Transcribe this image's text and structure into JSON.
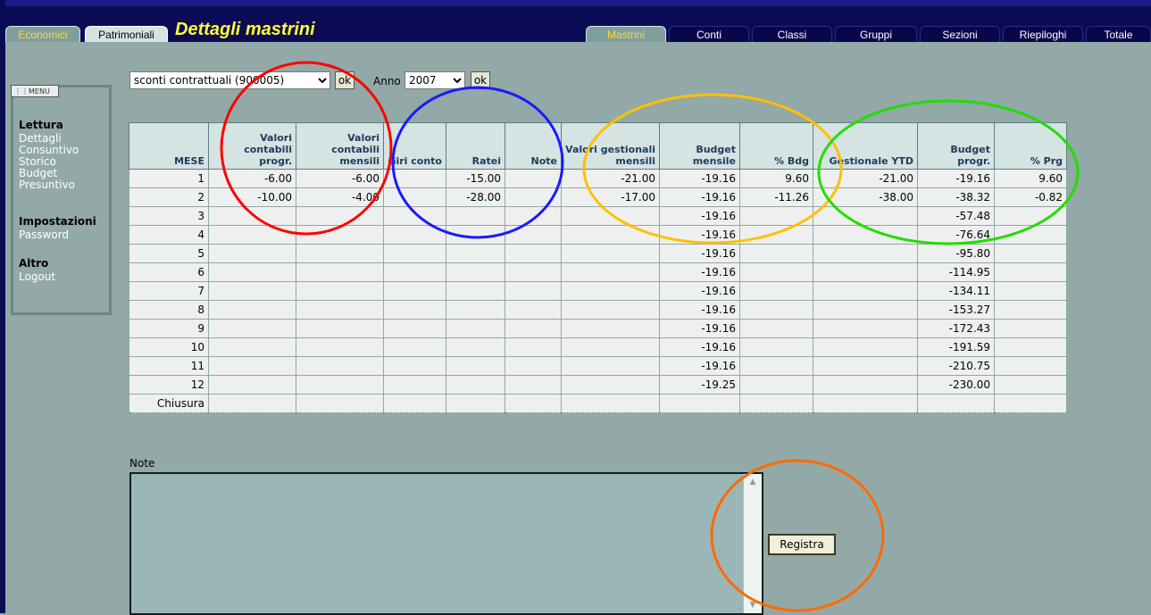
{
  "header": {
    "title": "Dettagli mastrini",
    "left_tabs": [
      {
        "label": "Economici",
        "active": true
      },
      {
        "label": "Patrimoniali",
        "active": false
      }
    ],
    "right_tabs": [
      {
        "label": "Mastrini",
        "active": true
      },
      {
        "label": "Conti",
        "active": false
      },
      {
        "label": "Classi",
        "active": false
      },
      {
        "label": "Gruppi",
        "active": false
      },
      {
        "label": "Sezioni",
        "active": false
      },
      {
        "label": "Riepiloghi",
        "active": false
      },
      {
        "label": "Totale",
        "active": false
      }
    ]
  },
  "menu": {
    "header": "MENU",
    "sections": [
      {
        "title": "Lettura",
        "items": [
          "Dettagli",
          "Consuntivo",
          "Storico",
          "Budget",
          "Presuntivo"
        ]
      },
      {
        "title": "Impostazioni",
        "items": [
          "Password"
        ]
      },
      {
        "title": "Altro",
        "items": [
          "Logout"
        ]
      }
    ]
  },
  "filters": {
    "account_selected": "sconti contrattuali (900005)",
    "ok_label": "ok",
    "year_label": "Anno",
    "year_selected": "2007"
  },
  "table": {
    "headers": [
      "MESE",
      "Valori contabili progr.",
      "Valori contabili mensili",
      "Giri conto",
      "Ratei",
      "Note",
      "Valori gestionali mensili",
      "Budget mensile",
      "% Bdg",
      "Gestionale YTD",
      "Budget progr.",
      "% Prg"
    ],
    "rows": [
      [
        "1",
        "-6.00",
        "-6.00",
        "",
        "-15.00",
        "",
        "-21.00",
        "-19.16",
        "9.60",
        "-21.00",
        "-19.16",
        "9.60"
      ],
      [
        "2",
        "-10.00",
        "-4.00",
        "",
        "-28.00",
        "",
        "-17.00",
        "-19.16",
        "-11.26",
        "-38.00",
        "-38.32",
        "-0.82"
      ],
      [
        "3",
        "",
        "",
        "",
        "",
        "",
        "",
        "-19.16",
        "",
        "",
        "-57.48",
        ""
      ],
      [
        "4",
        "",
        "",
        "",
        "",
        "",
        "",
        "-19.16",
        "",
        "",
        "-76.64",
        ""
      ],
      [
        "5",
        "",
        "",
        "",
        "",
        "",
        "",
        "-19.16",
        "",
        "",
        "-95.80",
        ""
      ],
      [
        "6",
        "",
        "",
        "",
        "",
        "",
        "",
        "-19.16",
        "",
        "",
        "-114.95",
        ""
      ],
      [
        "7",
        "",
        "",
        "",
        "",
        "",
        "",
        "-19.16",
        "",
        "",
        "-134.11",
        ""
      ],
      [
        "8",
        "",
        "",
        "",
        "",
        "",
        "",
        "-19.16",
        "",
        "",
        "-153.27",
        ""
      ],
      [
        "9",
        "",
        "",
        "",
        "",
        "",
        "",
        "-19.16",
        "",
        "",
        "-172.43",
        ""
      ],
      [
        "10",
        "",
        "",
        "",
        "",
        "",
        "",
        "-19.16",
        "",
        "",
        "-191.59",
        ""
      ],
      [
        "11",
        "",
        "",
        "",
        "",
        "",
        "",
        "-19.16",
        "",
        "",
        "-210.75",
        ""
      ],
      [
        "12",
        "",
        "",
        "",
        "",
        "",
        "",
        "-19.25",
        "",
        "",
        "-230.00",
        ""
      ],
      [
        "Chiusura",
        "",
        "",
        "",
        "",
        "",
        "",
        "",
        "",
        "",
        "",
        ""
      ]
    ]
  },
  "notes": {
    "label": "Note",
    "value": "",
    "save_label": "Registra"
  },
  "colors": {
    "background": "#92a9a8",
    "topbar": "#0b0b55",
    "active_tab_text": "#ffd92f",
    "title": "#ffff33",
    "header_cell": "#d6e3e3",
    "circle_red": "#ff0000",
    "circle_blue": "#1a1aff",
    "circle_yellow": "#ffc000",
    "circle_green": "#22dd00",
    "circle_orange": "#ff6a00"
  }
}
